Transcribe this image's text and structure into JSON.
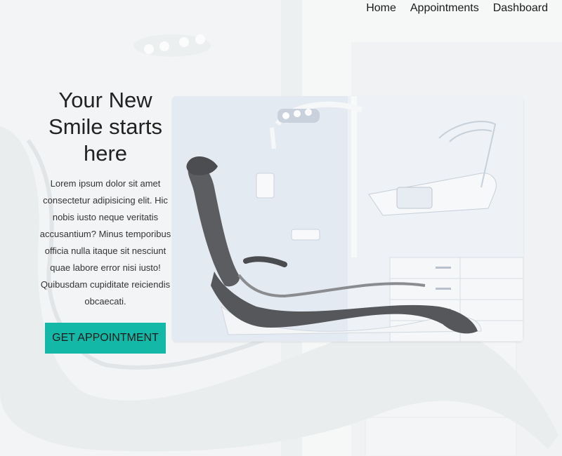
{
  "nav": {
    "items": [
      {
        "label": "Home"
      },
      {
        "label": "Appointments"
      },
      {
        "label": "Dashboard"
      }
    ]
  },
  "hero": {
    "title": "Your New Smile starts here",
    "description": "Lorem ipsum dolor sit amet consectetur adipisicing elit. Hic nobis iusto neque veritatis accusantium? Minus temporibus officia nulla itaque sit nesciunt quae labore error nisi iusto! Quibusdam cupiditate reiciendis obcaecati.",
    "cta_label": "GET APPOINTMENT",
    "image_description": "dental-chair-photo"
  },
  "colors": {
    "accent": "#14b8a6",
    "text": "#222222",
    "background": "#f1f3f4"
  }
}
